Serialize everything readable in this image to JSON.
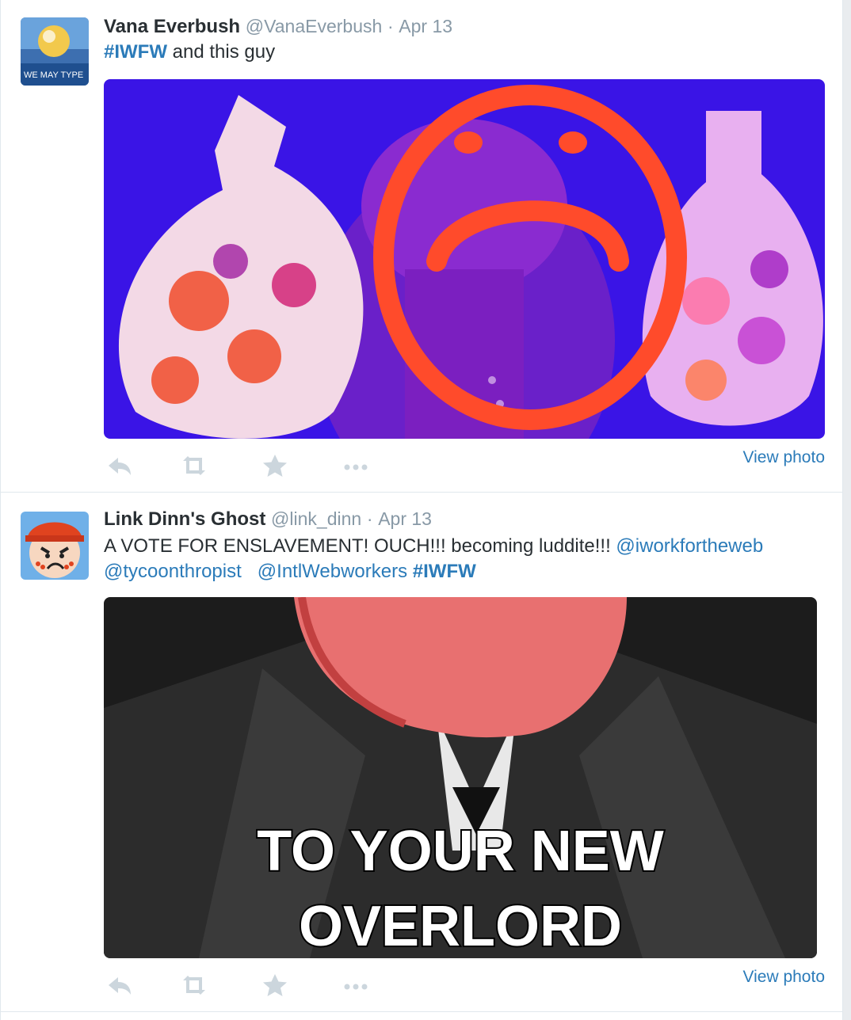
{
  "tweets": [
    {
      "fullname": "Vana Everbush",
      "username": "@VanaEverbush",
      "separator": "·",
      "time": "Apr 13",
      "text_hashtag": "#IWFW",
      "text_rest": " and this guy",
      "avatar_text": "WE MAY TYPE",
      "view_photo": "View photo"
    },
    {
      "fullname": "Link Dinn's Ghost",
      "username": "@link_dinn",
      "separator": "·",
      "time": "Apr 13",
      "text_plain": "A VOTE FOR ENSLAVEMENT! OUCH!!! becoming luddite!!! ",
      "mention_1": "@iworkfortheweb",
      "mention_2": "@tycoonthropist",
      "mention_3": "@IntlWebworkers",
      "text_hashtag": "#IWFW",
      "image_caption_line1": "TO YOUR NEW",
      "image_caption_line2": "OVERLORD",
      "view_photo": "View photo"
    }
  ],
  "icons": [
    "reply-icon",
    "retweet-icon",
    "favorite-icon",
    "more-icon"
  ],
  "colors": {
    "link": "#2b7bb9",
    "text": "#292f33",
    "meta": "#8899a6",
    "action_icon": "#ccd6dd"
  }
}
